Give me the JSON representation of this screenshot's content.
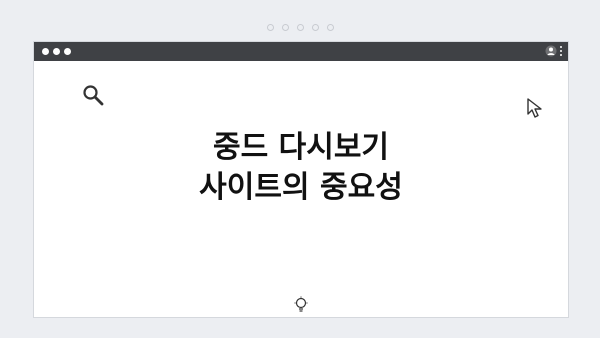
{
  "headline": {
    "line1": "중드 다시보기",
    "line2": "사이트의 중요성"
  },
  "icons": {
    "search": "search-icon",
    "cursor": "cursor-icon",
    "bulb": "lightbulb-icon",
    "user": "user-icon",
    "menu": "kebab-menu-icon"
  },
  "colors": {
    "titlebar": "#3f4145",
    "background": "#eceef2",
    "window": "#ffffff",
    "text": "#111111"
  }
}
